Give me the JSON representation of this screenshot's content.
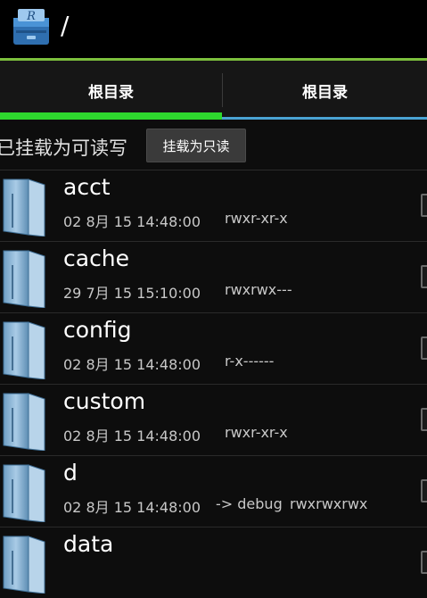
{
  "app": {
    "path_title": "/"
  },
  "tabs": [
    {
      "label": "根目录",
      "active": true
    },
    {
      "label": "根目录",
      "active": false
    }
  ],
  "mount": {
    "status_text": "已挂载为可读写",
    "button_label": "挂载为只读"
  },
  "colors": {
    "actionbar_line": "#7cbf3d",
    "active_tab_indicator": "#2ed82e",
    "inactive_tab_indicator": "#4aa3d4"
  },
  "files": [
    {
      "name": "acct",
      "date": "02 8月 15 14:48:00",
      "link": "",
      "perms": "rwxr-xr-x"
    },
    {
      "name": "cache",
      "date": "29 7月 15 15:10:00",
      "link": "",
      "perms": "rwxrwx---"
    },
    {
      "name": "config",
      "date": "02 8月 15 14:48:00",
      "link": "",
      "perms": "r-x------"
    },
    {
      "name": "custom",
      "date": "02 8月 15 14:48:00",
      "link": "",
      "perms": "rwxr-xr-x"
    },
    {
      "name": "d",
      "date": "02 8月 15 14:48:00",
      "link": "-> debug",
      "perms": "rwxrwxrwx"
    },
    {
      "name": "data",
      "date": "",
      "link": "",
      "perms": ""
    }
  ]
}
